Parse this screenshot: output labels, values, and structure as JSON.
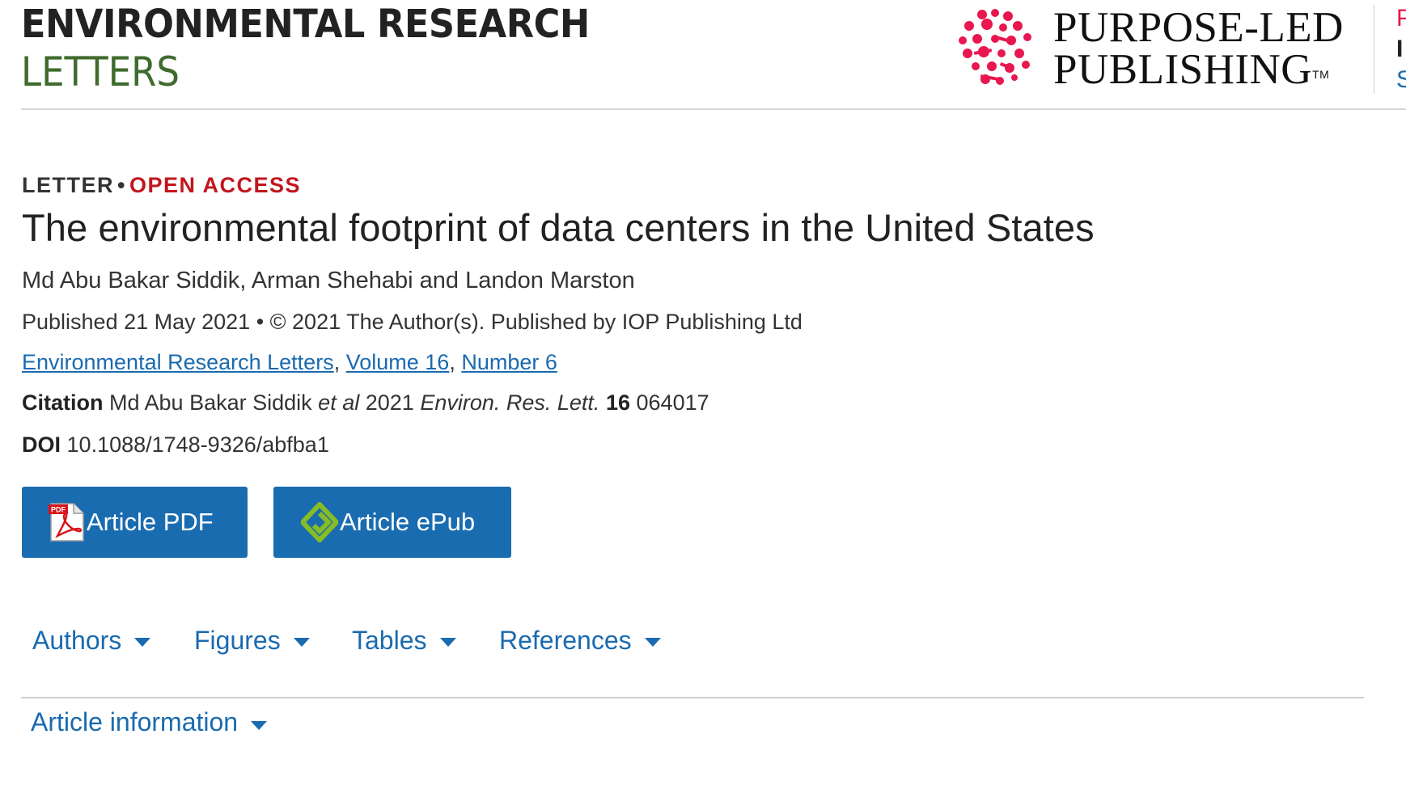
{
  "header": {
    "journal_name_line1": "ENVIRONMENTAL RESEARCH",
    "journal_name_line2": "LETTERS",
    "publisher_line1": "PURPOSE-LED",
    "publisher_line2": "PUBLISHING",
    "trademark": "TM",
    "cut_off_letters": [
      "P",
      "I",
      "S"
    ],
    "colors": {
      "journal_green": "#3f6b2e",
      "brand_pink": "#e8174f"
    }
  },
  "article": {
    "type": "LETTER",
    "separator": "•",
    "access": "OPEN ACCESS",
    "title": "The environmental footprint of data centers in the United States",
    "authors": "Md Abu Bakar Siddik, Arman Shehabi and Landon Marston",
    "published": "Published 21 May 2021 • © 2021 The Author(s). Published by IOP Publishing Ltd",
    "journal_link": "Environmental Research Letters",
    "volume_link": "Volume 16",
    "number_link": "Number 6",
    "comma": ",",
    "citation_label": "Citation",
    "citation_authors": "Md Abu Bakar Siddik",
    "citation_etal": "et al",
    "citation_year": "2021",
    "citation_journal": "Environ. Res. Lett.",
    "citation_volume": "16",
    "citation_article": "064017",
    "doi_label": "DOI",
    "doi": "10.1088/1748-9326/abfba1"
  },
  "buttons": {
    "pdf_label": "Article PDF",
    "pdf_icon": "pdf-icon",
    "pdf_icon_text": "PDF",
    "epub_label": "Article ePub",
    "epub_icon": "epub-icon"
  },
  "tabs": [
    {
      "label": "Authors"
    },
    {
      "label": "Figures"
    },
    {
      "label": "Tables"
    },
    {
      "label": "References"
    }
  ],
  "article_information": "Article information",
  "accent_color": "#1a6cb0",
  "open_access_color": "#c2161d"
}
